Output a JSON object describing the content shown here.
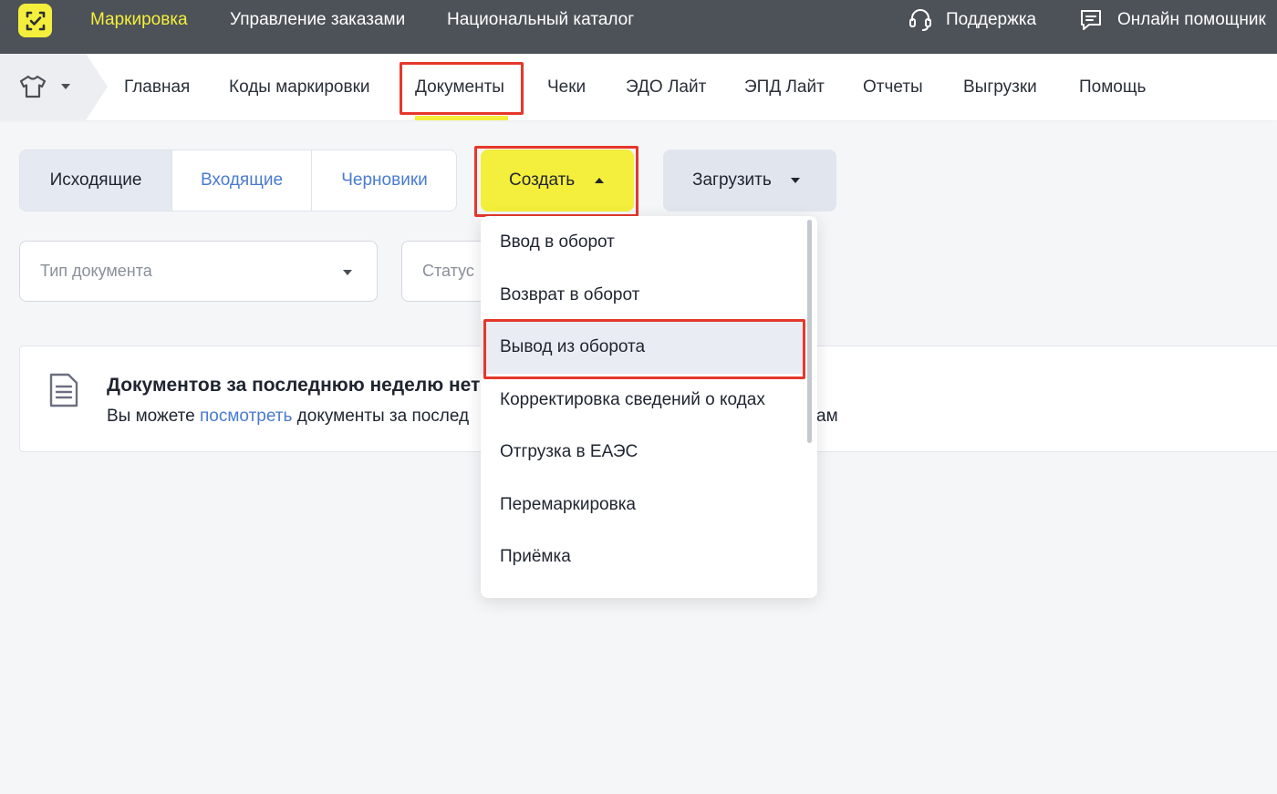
{
  "topbar": {
    "items": [
      {
        "label": "Маркировка",
        "active": true
      },
      {
        "label": "Управление заказами"
      },
      {
        "label": "Национальный каталог"
      }
    ],
    "support": {
      "label": "Поддержка",
      "icon": "headset-icon"
    },
    "assistant": {
      "label": "Онлайн помощник",
      "icon": "chat-icon"
    },
    "logo_icon": "check-logo-icon",
    "accent_color": "#f4ee3c",
    "bg_color": "#4d5258"
  },
  "subnav": {
    "category_icon": "tshirt-icon",
    "items": [
      {
        "label": "Главная"
      },
      {
        "label": "Коды маркировки"
      },
      {
        "label": "Документы",
        "active": true
      },
      {
        "label": "Чеки"
      },
      {
        "label": "ЭДО Лайт"
      },
      {
        "label": "ЭПД Лайт"
      },
      {
        "label": "Отчеты"
      },
      {
        "label": "Выгрузки"
      },
      {
        "label": "Помощь"
      }
    ]
  },
  "tabs": [
    {
      "label": "Исходящие",
      "active": true
    },
    {
      "label": "Входящие"
    },
    {
      "label": "Черновики"
    }
  ],
  "actions": {
    "create_label": "Создать",
    "load_label": "Загрузить"
  },
  "filters": {
    "doc_type_placeholder": "Тип документа",
    "status_placeholder": "Статус"
  },
  "info": {
    "title": "Документов за последнюю неделю нет",
    "text_prefix": "Вы можете ",
    "link": "посмотреть",
    "text_suffix": " документы за послед",
    "text_tail": "ам",
    "icon": "document-icon"
  },
  "dropdown": {
    "items": [
      {
        "label": "Ввод в оборот"
      },
      {
        "label": "Возврат в оборот"
      },
      {
        "label": "Вывод из оборота",
        "highlighted": true
      },
      {
        "label": "Корректировка сведений о кодах"
      },
      {
        "label": "Отгрузка в ЕАЭС"
      },
      {
        "label": "Перемаркировка"
      },
      {
        "label": "Приёмка"
      }
    ]
  }
}
